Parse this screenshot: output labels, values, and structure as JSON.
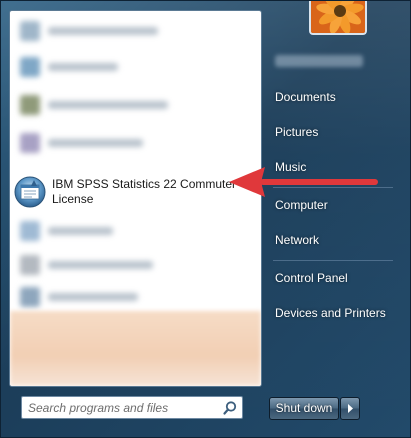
{
  "left_pane": {
    "highlighted_item": {
      "label": "IBM SPSS Statistics 22 Commuter License",
      "icon": "spss-app-icon"
    }
  },
  "search": {
    "placeholder": "Search programs and files",
    "icon": "search-icon"
  },
  "right_pane": {
    "items": [
      {
        "label": "Documents"
      },
      {
        "label": "Pictures"
      },
      {
        "label": "Music"
      },
      {
        "label": "Computer"
      },
      {
        "label": "Network"
      },
      {
        "label": "Control Panel"
      },
      {
        "label": "Devices and Printers"
      }
    ]
  },
  "shutdown": {
    "label": "Shut down",
    "arrow_icon": "chevron-right-icon"
  },
  "annotation": {
    "arrow_color": "#e0383b"
  }
}
